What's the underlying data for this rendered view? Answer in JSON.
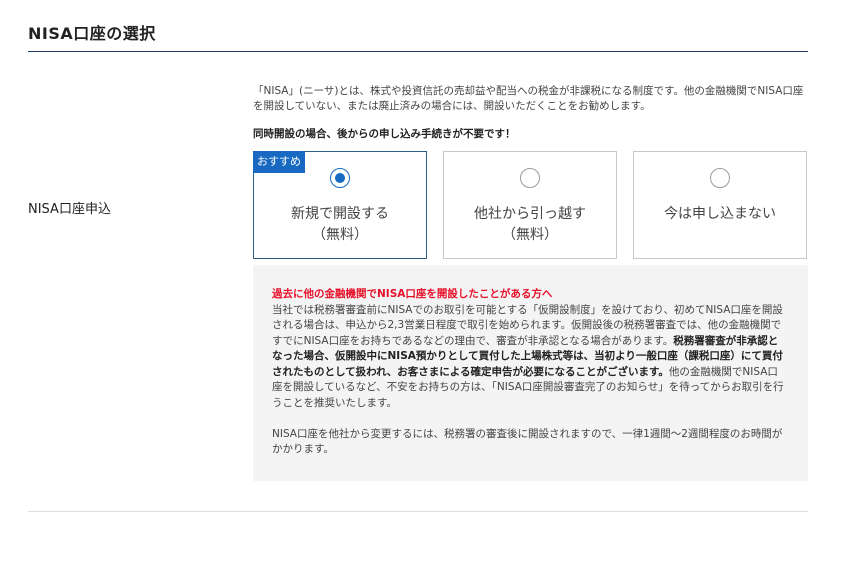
{
  "section": {
    "title": "NISA口座の選択"
  },
  "row": {
    "label": "NISA口座申込"
  },
  "intro": {
    "text": "「NISA」(ニーサ)とは、株式や投資信託の売却益や配当への税金が非課税になる制度です。他の金融機関でNISA口座を開設していない、または廃止済みの場合には、開設いただくことをお勧めします。",
    "notice": "同時開設の場合、後からの申し込み手続きが不要です！"
  },
  "options": [
    {
      "badge": "おすすめ",
      "line1": "新規で開設する",
      "line2": "（無料）",
      "selected": true
    },
    {
      "line1": "他社から引っ越す",
      "line2": "（無料）",
      "selected": false
    },
    {
      "line1": "今は申し込まない",
      "selected": false
    }
  ],
  "info": {
    "heading": "過去に他の金融機関でNISA口座を開設したことがある方へ",
    "para1": "当社では税務署審査前にNISAでのお取引を可能とする「仮開設制度」を設けており、初めてNISA口座を開設される場合は、申込から2,3営業日程度で取引を始められます。仮開設後の税務署審査では、他の金融機関ですでにNISA口座をお持ちであるなどの理由で、審査が非承認となる場合があります。",
    "para1_bold": "税務署審査が非承認となった場合、仮開設中にNISA預かりとして買付した上場株式等は、当初より一般口座（課税口座）にて買付されたものとして扱われ、お客さまによる確定申告が必要になることがございます。",
    "para1_tail": "他の金融機関でNISA口座を開設しているなど、不安をお持ちの方は、「NISA口座開設審査完了のお知らせ」を待ってからお取引を行うことを推奨いたします。",
    "para2": "NISA口座を他社から変更するには、税務署の審査後に開設されますので、一律1週間〜2週間程度のお時間がかかります。"
  },
  "colors": {
    "accent_blue": "#1769c2",
    "title_rule": "#1f3d6b",
    "warning_red": "#e8102a",
    "info_bg": "#f4f4f4"
  }
}
